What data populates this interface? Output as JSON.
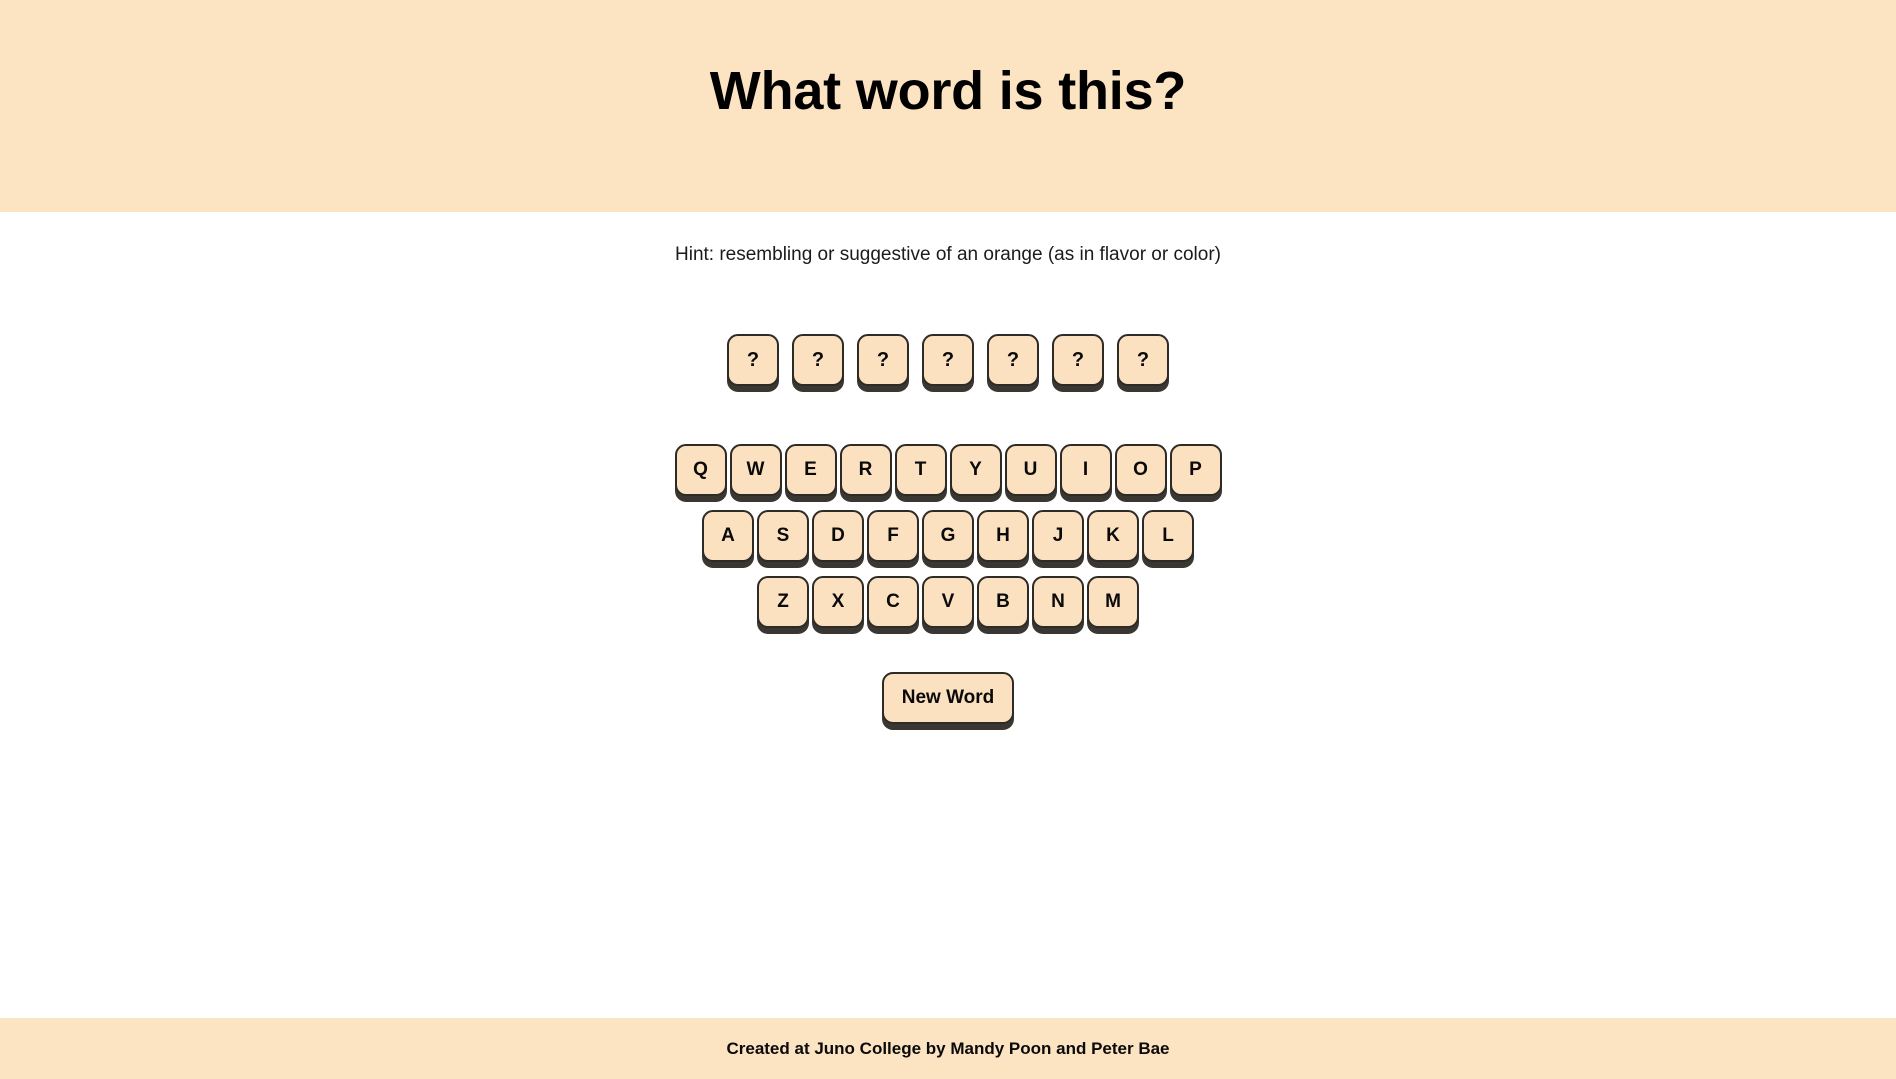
{
  "header": {
    "title": "What word is this?",
    "background_color": "#fce3c2"
  },
  "main": {
    "hint": "Hint: resembling or suggestive of an orange (as in flavor or color)",
    "answer": {
      "letter_count": 7,
      "tiles": [
        "?",
        "?",
        "?",
        "?",
        "?",
        "?",
        "?"
      ]
    },
    "keyboard": {
      "rows": [
        {
          "keys": [
            "Q",
            "W",
            "E",
            "R",
            "T",
            "Y",
            "U",
            "I",
            "O",
            "P"
          ]
        },
        {
          "keys": [
            "A",
            "S",
            "D",
            "F",
            "G",
            "H",
            "J",
            "K",
            "L"
          ]
        },
        {
          "keys": [
            "Z",
            "X",
            "C",
            "V",
            "B",
            "N",
            "M"
          ]
        }
      ]
    },
    "new_word_button_label": "New Word"
  },
  "footer": {
    "text": "Created at Juno College by Mandy Poon and Peter Bae",
    "background_color": "#fce3c2"
  },
  "theme": {
    "accent": "#fce3c2",
    "key_fill": "#fbe1c0",
    "key_border": "#2e2a26",
    "key_shadow": "#3a3632",
    "text": "#0a0a0a",
    "page_background": "#ffffff"
  }
}
